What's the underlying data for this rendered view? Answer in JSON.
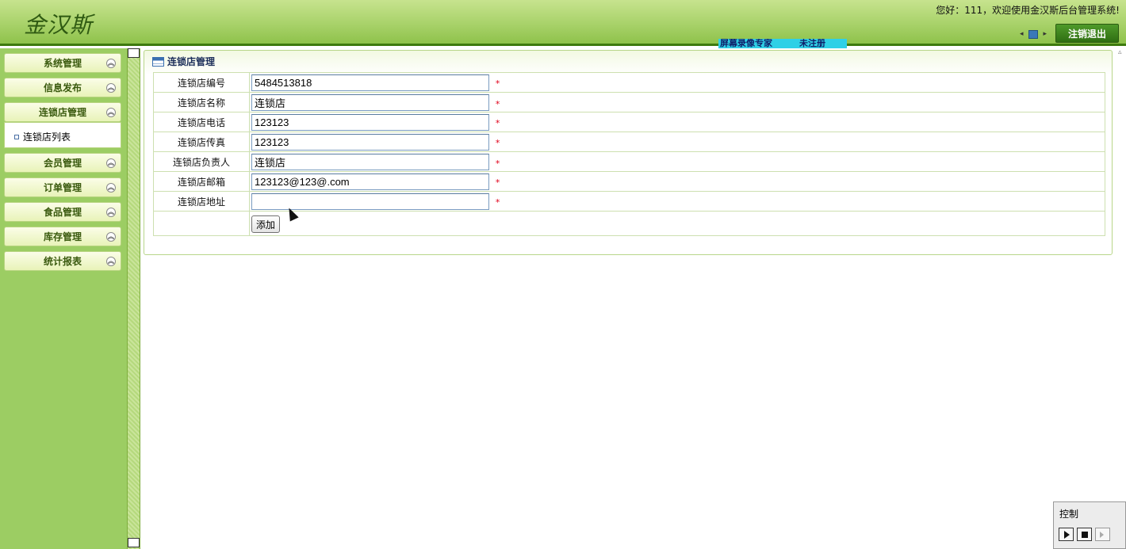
{
  "header": {
    "logo": "金汉斯",
    "welcome": "您好：111，欢迎使用金汉斯后台管理系统!",
    "logout_label": "注销退出",
    "watermark_left": "屏幕录像专家",
    "watermark_right": "未注册"
  },
  "sidebar": {
    "menus": [
      {
        "label": "系统管理"
      },
      {
        "label": "信息发布"
      },
      {
        "label": "连锁店管理"
      },
      {
        "label": "会员管理"
      },
      {
        "label": "订单管理"
      },
      {
        "label": "食品管理"
      },
      {
        "label": "库存管理"
      },
      {
        "label": "统计报表"
      }
    ],
    "submenu_item": "连锁店列表"
  },
  "panel": {
    "title": "连锁店管理",
    "fields": [
      {
        "label": "连锁店编号",
        "value": "5484513818"
      },
      {
        "label": "连锁店名称",
        "value": "连锁店"
      },
      {
        "label": "连锁店电话",
        "value": "123123"
      },
      {
        "label": "连锁店传真",
        "value": "123123"
      },
      {
        "label": "连锁店负责人",
        "value": "连锁店"
      },
      {
        "label": "连锁店邮箱",
        "value": "123123@123@.com"
      },
      {
        "label": "连锁店地址",
        "value": ""
      }
    ],
    "required_mark": "*",
    "add_label": "添加"
  },
  "control": {
    "title": "控制"
  }
}
